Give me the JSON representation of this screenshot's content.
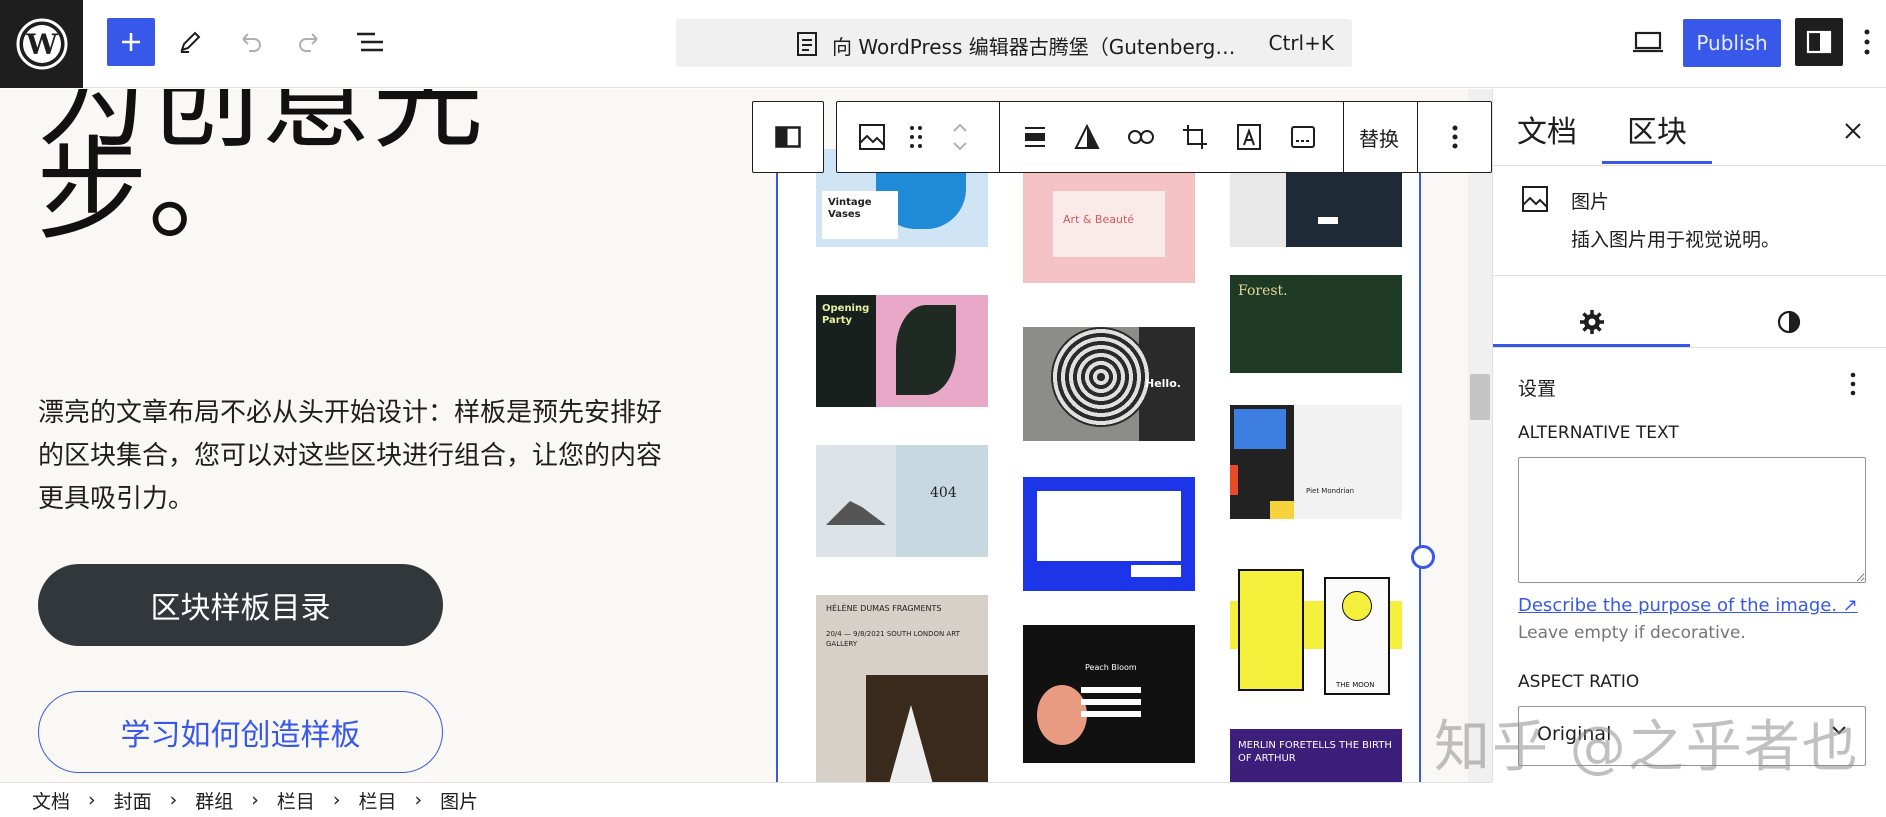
{
  "header": {
    "command_title": "向 WordPress 编辑器古腾堡（Gutenberg…",
    "shortcut": "Ctrl+K",
    "publish_label": "Publish"
  },
  "canvas": {
    "hero_line1": "为创意先",
    "hero_line2": "步。",
    "paragraph": "漂亮的文章布局不必从头开始设计：样板是预先安排好的区块集合，您可以对这些区块进行组合，让您的内容更具吸引力。",
    "primary_button": "区块样板目录",
    "secondary_button": "学习如何创造样板"
  },
  "patterns": [
    {
      "id": "vases",
      "title": "Vintage Vases",
      "bg": "#cfe4f4"
    },
    {
      "id": "art",
      "title": "Art & Beauté",
      "bg": "#f4c2c2"
    },
    {
      "id": "dark-card",
      "title": "",
      "bg": "#1f2a37"
    },
    {
      "id": "opening",
      "title": "Opening Party",
      "bg": "#17201c"
    },
    {
      "id": "hello",
      "title": "Hello.",
      "bg": "#2a2a2a"
    },
    {
      "id": "forest",
      "title": "Forest.",
      "bg": "#1e3a24"
    },
    {
      "id": "404",
      "title": "404",
      "bg": "#c8d8e0"
    },
    {
      "id": "blue",
      "title": "",
      "bg": "#1c35e8"
    },
    {
      "id": "mondrian",
      "title": "Piet Mondrian",
      "bg": "#f2f2f2"
    },
    {
      "id": "gallery",
      "title": "HÉLÈNE DUMAS FRAGMENTS",
      "sub": "20/4 — 9/8/2021 SOUTH LONDON ART GALLERY",
      "bg": "#d6d0c8"
    },
    {
      "id": "peach",
      "title": "Peach Bloom",
      "bg": "#111111"
    },
    {
      "id": "tarot",
      "title": "THE MOON",
      "bg": "#ffffff"
    },
    {
      "id": "merlin",
      "title": "MERLIN FORETELLS THE BIRTH OF ARTHUR",
      "bg": "#3b1f7a"
    }
  ],
  "toolbar": {
    "replace_label": "替换"
  },
  "sidebar": {
    "tab_document": "文档",
    "tab_block": "区块",
    "block_name": "图片",
    "block_desc": "插入图片用于视觉说明。",
    "panel_title": "设置",
    "alt_label": "ALTERNATIVE TEXT",
    "alt_value": "",
    "alt_link": "Describe the purpose of the image. ↗",
    "alt_help": "Leave empty if decorative.",
    "aspect_label": "ASPECT RATIO",
    "aspect_value": "Original"
  },
  "breadcrumb": [
    "文档",
    "封面",
    "群组",
    "栏目",
    "栏目",
    "图片"
  ],
  "watermark": "知乎 @之乎者也",
  "colors": {
    "accent": "#3858e9",
    "dark": "#1e1e1e"
  }
}
